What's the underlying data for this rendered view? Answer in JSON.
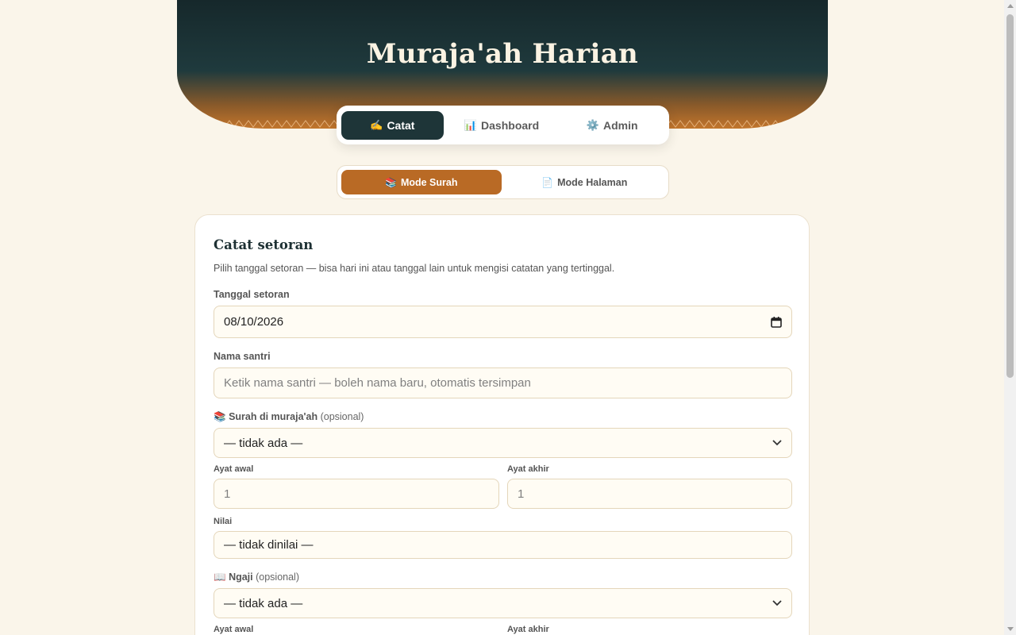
{
  "header": {
    "title": "Muraja'ah Harian"
  },
  "nav": {
    "tabs": [
      {
        "icon": "✍️",
        "label": "Catat",
        "active": true
      },
      {
        "icon": "📊",
        "label": "Dashboard",
        "active": false
      },
      {
        "icon": "⚙️",
        "label": "Admin",
        "active": false
      }
    ]
  },
  "mode": {
    "options": [
      {
        "icon": "📚",
        "label": "Mode Surah",
        "active": true
      },
      {
        "icon": "📄",
        "label": "Mode Halaman",
        "active": false
      }
    ]
  },
  "form": {
    "title": "Catat setoran",
    "description": "Pilih tanggal setoran — bisa hari ini atau tanggal lain untuk mengisi catatan yang tertinggal.",
    "date_label": "Tanggal setoran",
    "date_value": "08/10/2026",
    "name_label": "Nama santri",
    "name_placeholder": "Ketik nama santri — boleh nama baru, otomatis tersimpan",
    "surah_icon": "📚",
    "surah_label": "Surah di muraja'ah",
    "surah_optional": "(opsional)",
    "surah_value": "— tidak ada —",
    "ayat_awal_label": "Ayat awal",
    "ayat_awal_placeholder": "1",
    "ayat_akhir_label": "Ayat akhir",
    "ayat_akhir_placeholder": "1",
    "nilai_label": "Nilai",
    "nilai_value": "— tidak dinilai —",
    "ngaji_icon": "📖",
    "ngaji_label": "Ngaji",
    "ngaji_optional": "(opsional)",
    "ngaji_value": "— tidak ada —",
    "ngaji_ayat_awal_label": "Ayat awal",
    "ngaji_ayat_akhir_label": "Ayat akhir"
  },
  "colors": {
    "primary": "#1e3538",
    "accent": "#b96a25",
    "background": "#faf5ea"
  }
}
